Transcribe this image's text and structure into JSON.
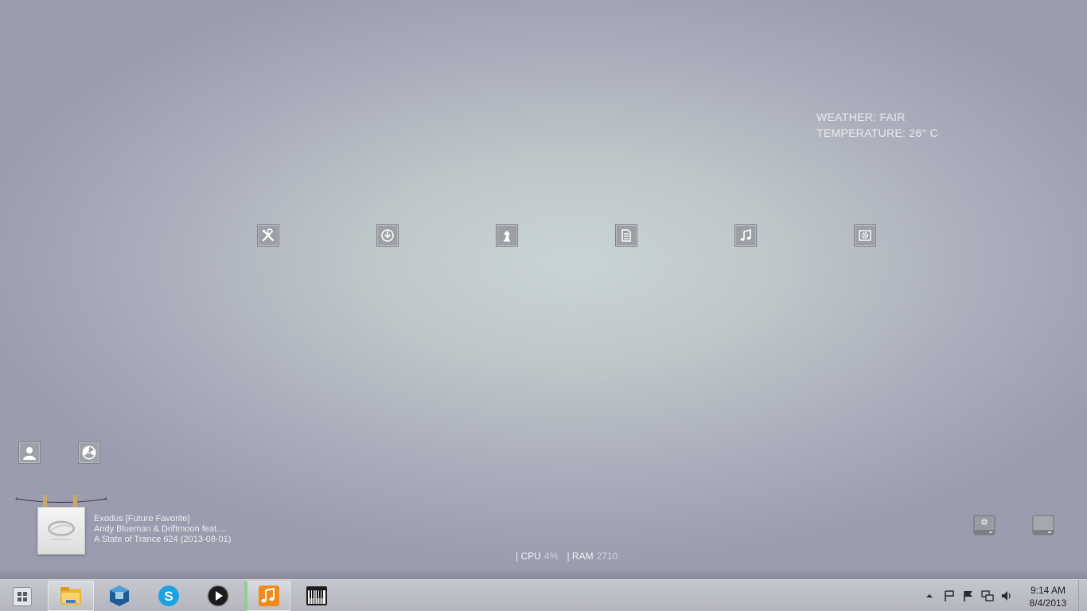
{
  "weather": {
    "condition": "WEATHER: FAIR",
    "temperature": "TEMPERATURE: 26° C"
  },
  "launcher": [
    {
      "icon": "tools-icon"
    },
    {
      "icon": "download-icon"
    },
    {
      "icon": "chess-knight-icon"
    },
    {
      "icon": "document-icon"
    },
    {
      "icon": "music-note-icon"
    },
    {
      "icon": "settings-icon"
    }
  ],
  "shortcuts": [
    {
      "icon": "user-icon"
    },
    {
      "icon": "radiation-icon"
    }
  ],
  "now_playing": {
    "title": "Exodus [Future Favorite]",
    "artist": "Andy Blueman & Driftmoon feat....",
    "album": "A State of Trance 624 (2013-08-01)"
  },
  "system_stats": {
    "cpu_label": "| CPU",
    "cpu_value": "4%",
    "ram_label": "| RAM",
    "ram_value": "2710"
  },
  "drives": [
    {
      "icon": "system-drive-icon"
    },
    {
      "icon": "hard-drive-icon"
    }
  ],
  "taskbar": {
    "apps": [
      {
        "name": "file-explorer-icon",
        "active": true
      },
      {
        "name": "virtualbox-icon",
        "active": false
      },
      {
        "name": "skype-icon",
        "active": false
      },
      {
        "name": "media-player-icon",
        "active": false
      },
      {
        "name": "itunes-icon",
        "active": true
      },
      {
        "name": "piano-icon",
        "active": false
      }
    ],
    "clock": {
      "time": "9:14 AM",
      "date": "8/4/2013"
    }
  },
  "colors": {
    "accent": "#f08a1c",
    "skype": "#1aa3e2"
  }
}
